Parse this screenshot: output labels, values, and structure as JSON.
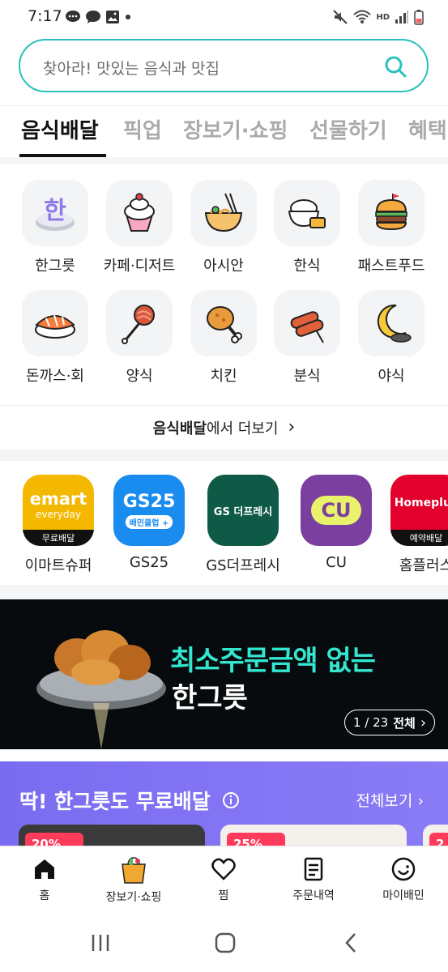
{
  "status_bar": {
    "time": "7:17",
    "network_label": "HD"
  },
  "search": {
    "placeholder": "찾아라! 맛있는 음식과 맛집"
  },
  "tabs": [
    {
      "label": "음식배달",
      "active": true
    },
    {
      "label": "픽업",
      "active": false
    },
    {
      "label": "장보기·쇼핑",
      "active": false
    },
    {
      "label": "선물하기",
      "active": false
    },
    {
      "label": "혜택",
      "active": false
    }
  ],
  "categories": [
    {
      "label": "한그릇",
      "icon": "hangeureut-bowl-icon",
      "glyph": "한"
    },
    {
      "label": "카페·디저트",
      "icon": "cupcake-icon"
    },
    {
      "label": "아시안",
      "icon": "noodle-bowl-icon"
    },
    {
      "label": "한식",
      "icon": "rice-bowl-icon"
    },
    {
      "label": "패스트푸드",
      "icon": "burger-icon"
    },
    {
      "label": "돈까스·회",
      "icon": "sushi-icon"
    },
    {
      "label": "양식",
      "icon": "pasta-fork-icon"
    },
    {
      "label": "치킨",
      "icon": "chicken-leg-icon"
    },
    {
      "label": "분식",
      "icon": "tteokbokki-icon"
    },
    {
      "label": "야식",
      "icon": "moon-icon"
    }
  ],
  "more_link": {
    "bold": "음식배달",
    "rest": "에서 더보기",
    "chevron": "›"
  },
  "stores": [
    {
      "label": "이마트슈퍼",
      "logo_line1": "emart",
      "logo_line2": "everyday",
      "badge": "무료배달",
      "color": "#f5b800"
    },
    {
      "label": "GS25",
      "logo_line1": "GS25",
      "logo_line2": "배민클럽 +",
      "color": "#1a8cf0"
    },
    {
      "label": "GS더프레시",
      "logo_line1": "GS 더프레시",
      "color": "#0f5a46"
    },
    {
      "label": "CU",
      "logo_line1": "CU",
      "color": "#7b3fa0"
    },
    {
      "label": "홈플러스",
      "logo_line1": "Homeplus",
      "badge": "예약배달",
      "color": "#e3002d"
    }
  ],
  "banner": {
    "title_line1": "최소주문금액 없는",
    "title_line2": "한그릇",
    "pager": "1 / 23",
    "pager_all": "전체",
    "chevron": "›"
  },
  "promo": {
    "title": "딱! 한그릇도 무료배달",
    "info_icon": "info-icon",
    "link": "전체보기",
    "chevron": "›",
    "card1_badge": "20%",
    "card2_badge": "25%",
    "card3_badge": "2"
  },
  "bottom_nav": [
    {
      "label": "홈",
      "icon": "home-icon",
      "active": true
    },
    {
      "label": "장보기·쇼핑",
      "icon": "grocery-bag-icon",
      "active": false
    },
    {
      "label": "찜",
      "icon": "heart-icon",
      "active": false
    },
    {
      "label": "주문내역",
      "icon": "receipt-icon",
      "active": false
    },
    {
      "label": "마이배민",
      "icon": "profile-face-icon",
      "active": false
    }
  ],
  "colors": {
    "accent": "#2ac1bc",
    "promo": "#7a6cf0",
    "banner_text": "#34e6cf"
  }
}
